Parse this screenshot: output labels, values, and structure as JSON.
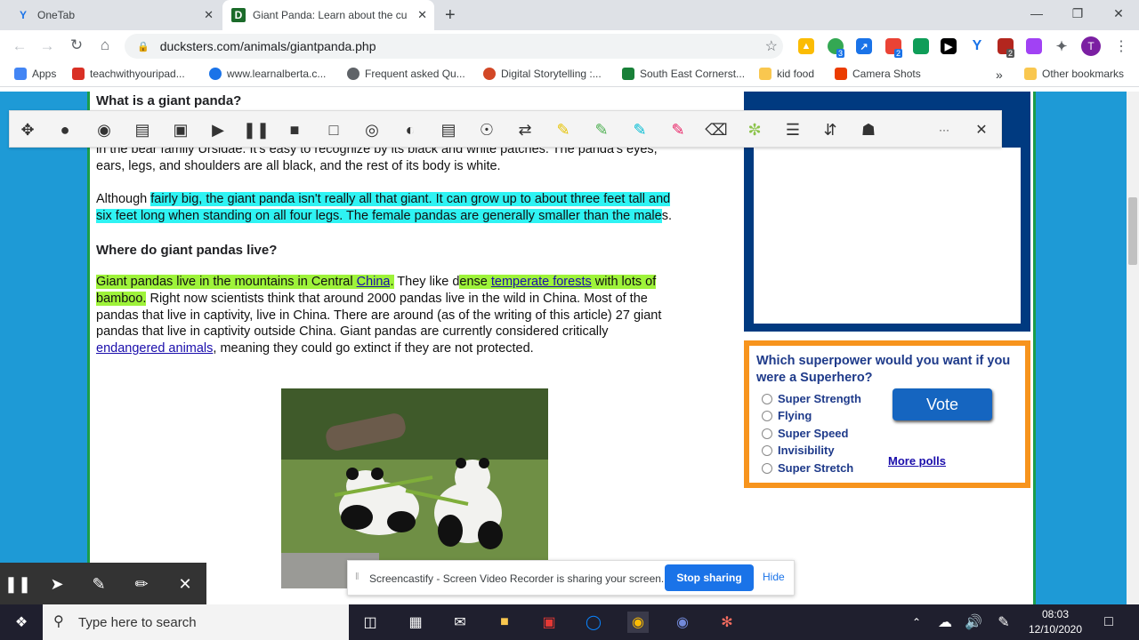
{
  "tabs": [
    {
      "title": "OneTab",
      "icon": "onetab-icon"
    },
    {
      "title": "Giant Panda: Learn about the cu",
      "icon": "ducksters-icon"
    }
  ],
  "window": {
    "new_tab": "+",
    "close_tab": "✕"
  },
  "address": {
    "url": "ducksters.com/animals/giantpanda.php"
  },
  "bookmarks": {
    "items": [
      "Apps",
      "teachwithyouripad...",
      "www.learnalberta.c...",
      "Frequent asked Qu...",
      "Digital Storytelling :...",
      "South East Cornerst...",
      "kid food",
      "Camera Shots"
    ],
    "more": "»",
    "other": "Other bookmarks"
  },
  "profile_initial": "T",
  "ext_badges": [
    "3",
    "2",
    "2"
  ],
  "article": {
    "h_what": "What is a giant panda?",
    "p1_line1": "in the bear family Ursidae. It's easy to recognize by its black and white patches. The panda's eyes,",
    "p1_line2": "ears, legs, and shoulders are all black, and the rest of its body is white.",
    "p2_a": "Although ",
    "p2_hl1": "fairly big, the giant panda isn't really all that giant. It can grow up to about three feet tall and",
    "p2_hl2": "six feet long when standing on all four legs. The female pandas are generally smaller than the male",
    "p2_end": "s.",
    "h_where": "Where do giant pandas live?",
    "p3_hl1": "Giant pandas live in the mountains in Central ",
    "p3_link1": "China",
    "p3_hl1b": ".",
    "p3_b": " They like d",
    "p3_hl2": "ense ",
    "p3_link2": "temperate forests",
    "p3_hl2b": " with lots of",
    "p3_hl3": "bamboo.",
    "p3_rest1": " Right now scientists think that around 2000 pandas live in the wild in China. Most of the",
    "p3_rest2": "pandas that live in captivity, live in China. There are around (as of the writing of this article) 27 giant",
    "p3_rest3": "pandas that live in captivity outside China. Giant pandas are currently considered critically",
    "p3_link3": "endangered animals",
    "p3_rest4": ", meaning they could go extinct if they are not protected."
  },
  "poll": {
    "question": "Which superpower would you want if you were a Superhero?",
    "options": [
      "Super Strength",
      "Flying",
      "Super Speed",
      "Invisibility",
      "Super Stretch"
    ],
    "vote": "Vote",
    "more": "More polls"
  },
  "readbar": {
    "more": "···",
    "close": "✕"
  },
  "sharing": {
    "message": "Screencastify - Screen Video Recorder is sharing your screen.",
    "stop": "Stop sharing",
    "hide": "Hide"
  },
  "taskbar": {
    "search_placeholder": "Type here to search",
    "time": "08:03",
    "date": "12/10/2020"
  },
  "colors": {
    "highlight_cyan": "#2ff3f3",
    "highlight_green": "#9ef33a",
    "page_bg": "#1e9ad6",
    "poll_border": "#f7941d",
    "ad_border": "#003a80"
  }
}
